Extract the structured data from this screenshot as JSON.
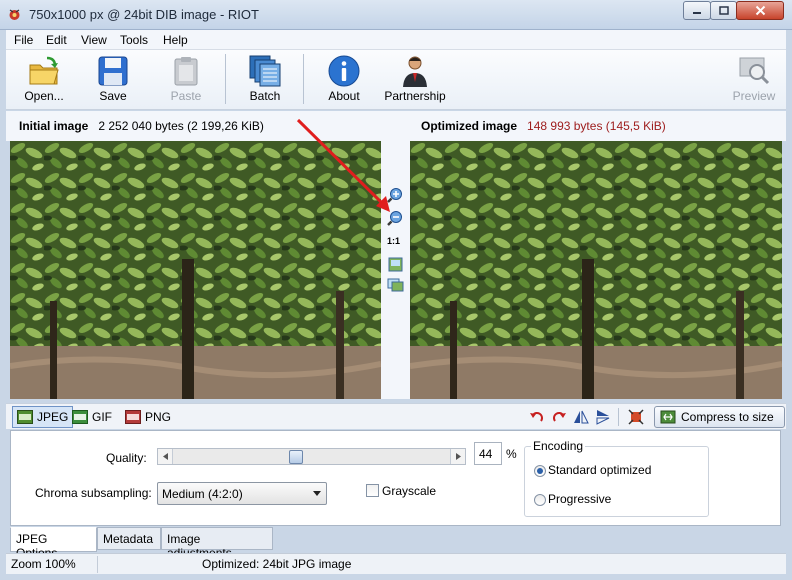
{
  "window": {
    "title": "750x1000 px @ 24bit  DIB image - RIOT",
    "icon": "riot-app-icon",
    "buttons": [
      "minimize-icon",
      "maximize-icon",
      "close-icon"
    ]
  },
  "menu": [
    "File",
    "Edit",
    "View",
    "Tools",
    "Help"
  ],
  "toolbar": {
    "open": "Open...",
    "save": "Save",
    "paste": "Paste",
    "batch": "Batch",
    "about": "About",
    "partnership": "Partnership",
    "preview": "Preview"
  },
  "info": {
    "initial_label": "Initial image",
    "initial_size": "2 252 040 bytes (2 199,26 KiB)",
    "optimized_label": "Optimized image",
    "optimized_size": "148 993 bytes (145,5 KiB)",
    "size_color": "#9d1b1b"
  },
  "zoom_controls": {
    "zoom_in": "zoom-in-icon",
    "zoom_out": "zoom-out-icon",
    "actual": "1:1",
    "fit": "fit-image-icon",
    "compare": "compare-icon"
  },
  "formats": [
    {
      "label": "JPEG",
      "selected": true
    },
    {
      "label": "GIF",
      "selected": false
    },
    {
      "label": "PNG",
      "selected": false
    }
  ],
  "compress_label": "Compress to size",
  "options": {
    "quality_label": "Quality:",
    "quality_value": "44",
    "quality_unit": "%",
    "quality_fraction": 0.44,
    "chroma_label": "Chroma subsampling:",
    "chroma_value": "Medium (4:2:0)",
    "grayscale_label": "Grayscale",
    "encoding_label": "Encoding",
    "encoding_standard": "Standard optimized",
    "encoding_progressive": "Progressive"
  },
  "tabs": [
    "JPEG Options",
    "Metadata",
    "Image adjustments"
  ],
  "status": {
    "zoom": "Zoom 100%",
    "message": "Optimized: 24bit JPG image"
  },
  "colors": {
    "accent": "#2a5fa8",
    "window_bg": "#c9d6e6"
  }
}
